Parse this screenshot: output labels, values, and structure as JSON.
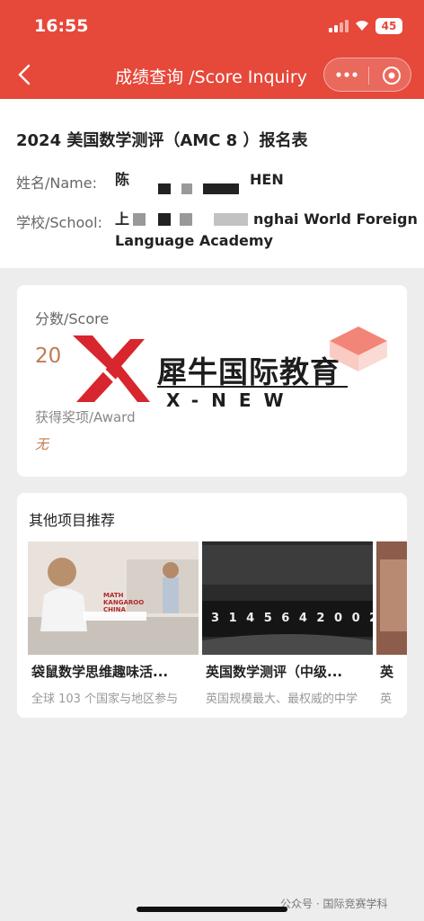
{
  "status": {
    "time": "16:55",
    "battery": "45"
  },
  "nav": {
    "title": "成绩查询 /Score Inquiry"
  },
  "form": {
    "title": "2024 美国数学测评（AMC 8 ）报名表",
    "name_label": "姓名/Name:",
    "name_value_start": "陈",
    "name_value_end": "HEN",
    "school_label": "学校/School:",
    "school_value_start": "上",
    "school_value_line1_end": "nghai World Foreign",
    "school_value_line2": "Language Academy"
  },
  "score": {
    "label": "分数/Score",
    "value": "20",
    "award_label": "获得奖项/Award",
    "award_value": "无"
  },
  "watermark": {
    "cn": "犀牛国际教育",
    "en": "X-NEW"
  },
  "other": {
    "title": "其他项目推荐",
    "items": [
      {
        "title": "袋鼠数学思维趣味活...",
        "desc": "全球 103 个国家与地区参与",
        "badge": "MATH KANGAROO CHINA"
      },
      {
        "title": "英国数学测评（中级...",
        "desc": "英国规模最大、最权威的中学",
        "counter": "3 1 4 5 6 4 2 0 0 2"
      },
      {
        "title": "英",
        "desc": "英"
      }
    ]
  },
  "footer": {
    "text": "公众号 · 国际竞赛学科"
  },
  "colors": {
    "header": "#e6483a",
    "score": "#c27a52"
  }
}
